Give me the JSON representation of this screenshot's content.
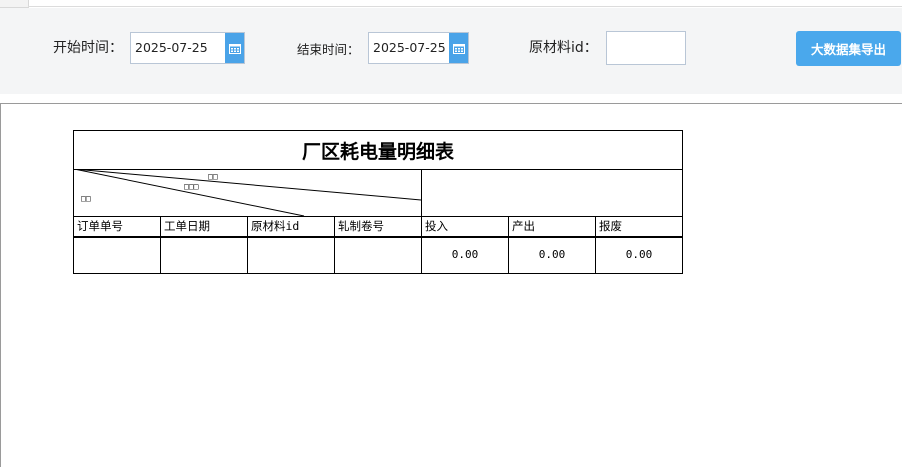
{
  "filters": {
    "start_label": "开始时间：",
    "start_value": "2025-07-25",
    "end_label": "结束时间：",
    "end_value": "2025-07-25",
    "material_label": "原材料id：",
    "material_value": "",
    "export_label": "大数据集导出",
    "calendar_icon": "calendar-icon",
    "accent_color": "#4aa8ec"
  },
  "report": {
    "title": "厂区耗电量明细表",
    "diagonal_marks": [
      "□□",
      "□□□",
      "□□"
    ],
    "columns": [
      "订单单号",
      "工单日期",
      "原材料id",
      "轧制卷号",
      "投入",
      "产出",
      "报废"
    ],
    "rows": [
      [
        "",
        "",
        "",
        "",
        "0.00",
        "0.00",
        "0.00"
      ]
    ]
  }
}
